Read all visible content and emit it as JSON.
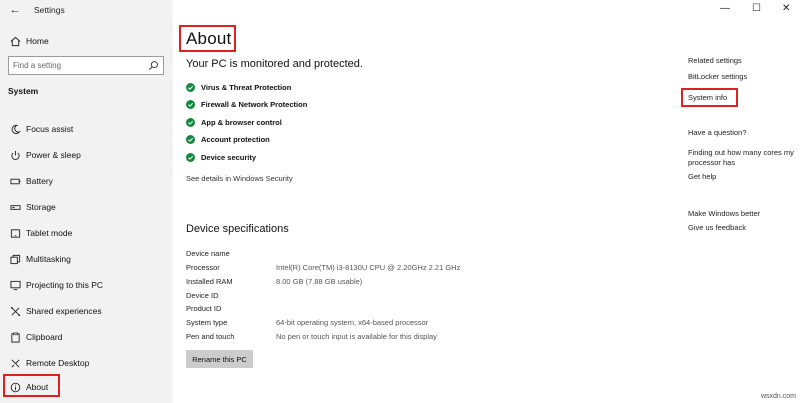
{
  "window": {
    "app_title": "Settings",
    "controls": {
      "minimize": "—",
      "maximize": "☐",
      "close": "✕"
    }
  },
  "sidebar": {
    "home_label": "Home",
    "search_placeholder": "Find a setting",
    "section_title": "System",
    "items": [
      {
        "label": "Focus assist",
        "icon": "moon-icon"
      },
      {
        "label": "Power & sleep",
        "icon": "power-icon"
      },
      {
        "label": "Battery",
        "icon": "battery-icon"
      },
      {
        "label": "Storage",
        "icon": "storage-icon"
      },
      {
        "label": "Tablet mode",
        "icon": "tablet-icon"
      },
      {
        "label": "Multitasking",
        "icon": "multitasking-icon"
      },
      {
        "label": "Projecting to this PC",
        "icon": "projector-icon"
      },
      {
        "label": "Shared experiences",
        "icon": "shared-icon"
      },
      {
        "label": "Clipboard",
        "icon": "clipboard-icon"
      },
      {
        "label": "Remote Desktop",
        "icon": "remote-icon"
      },
      {
        "label": "About",
        "icon": "info-icon"
      }
    ]
  },
  "main": {
    "title": "About",
    "protection_heading": "Your PC is monitored and protected.",
    "protection_items": [
      "Virus & Threat Protection",
      "Firewall & Network Protection",
      "App & browser control",
      "Account protection",
      "Device security"
    ],
    "see_details": "See details in Windows Security",
    "device_heading": "Device specifications",
    "specs": [
      {
        "key": "Device name",
        "value": ""
      },
      {
        "key": "Processor",
        "value": "Intel(R) Core(TM) i3-8130U CPU @ 2.20GHz   2.21 GHz"
      },
      {
        "key": "Installed RAM",
        "value": "8.00 GB (7.88 GB usable)"
      },
      {
        "key": "Device ID",
        "value": ""
      },
      {
        "key": "Product ID",
        "value": ""
      },
      {
        "key": "System type",
        "value": "64-bit operating system, x64-based processor"
      },
      {
        "key": "Pen and touch",
        "value": "No pen or touch input is available for this display"
      }
    ],
    "rename_button": "Rename this PC"
  },
  "right_panel": {
    "related_title": "Related settings",
    "bitlocker_link": "BitLocker settings",
    "system_info_link": "System info",
    "question_title": "Have a question?",
    "cores_link_line1": "Finding out how many cores my",
    "cores_link_line2": "processor has",
    "get_help_link": "Get help",
    "better_title": "Make Windows better",
    "feedback_link": "Give us feedback"
  },
  "watermark": "wsxdn.com",
  "colors": {
    "accent_red": "#e02020",
    "check_green": "#0f8a3c",
    "sidebar_bg": "#f2f2f2"
  }
}
